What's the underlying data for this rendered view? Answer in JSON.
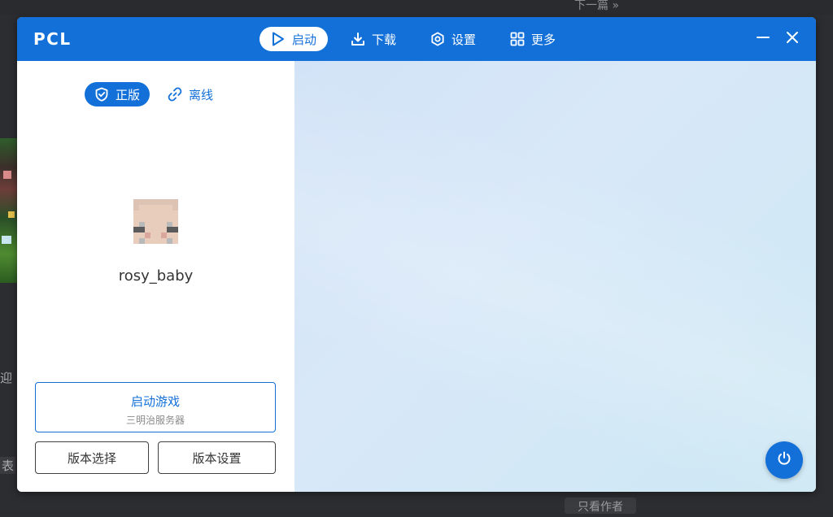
{
  "window": {
    "app_name": "PCL",
    "accent_color": "#1270d8"
  },
  "nav": {
    "items": [
      {
        "label": "启动",
        "icon": "play-icon",
        "active": true
      },
      {
        "label": "下载",
        "icon": "download-icon",
        "active": false
      },
      {
        "label": "设置",
        "icon": "gear-icon",
        "active": false
      },
      {
        "label": "更多",
        "icon": "grid-icon",
        "active": false
      }
    ]
  },
  "window_controls": {
    "minimize_icon": "minimize-icon",
    "close_icon": "close-icon"
  },
  "account": {
    "modes": [
      {
        "label": "正版",
        "icon": "shield-check-icon",
        "active": true
      },
      {
        "label": "离线",
        "icon": "link-icon",
        "active": false
      }
    ],
    "username": "rosy_baby"
  },
  "launch": {
    "title": "启动游戏",
    "subtitle": "三明治服务器",
    "version_select_label": "版本选择",
    "version_settings_label": "版本设置"
  },
  "power_icon": "power-icon",
  "background": {
    "next_article": "下一篇 »",
    "left_text_1": "迎",
    "left_text_2": "表",
    "bottom_tag": "只看作者"
  }
}
